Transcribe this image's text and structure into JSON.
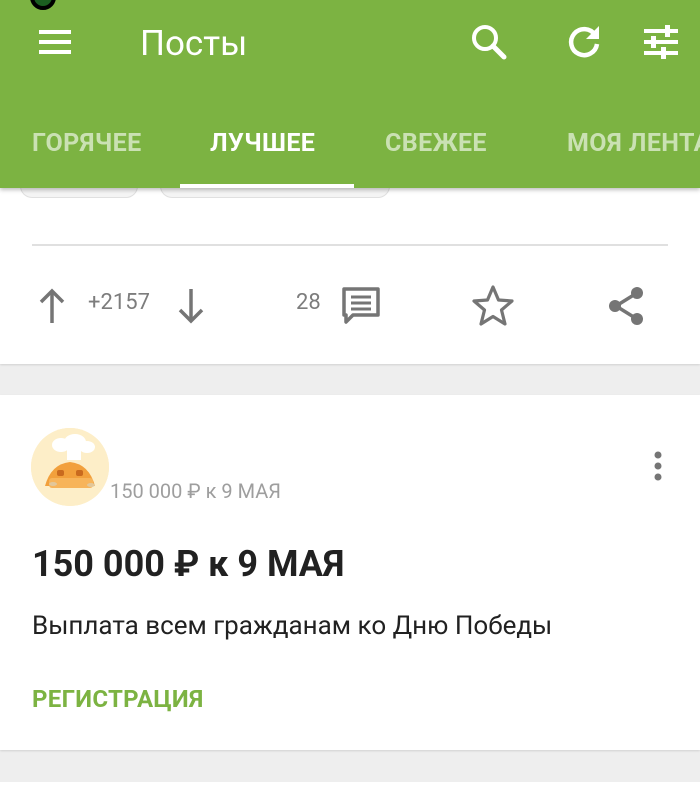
{
  "app_bar": {
    "title": "Посты",
    "menu_icon": "hamburger-menu-icon",
    "search_icon": "search-icon",
    "refresh_icon": "refresh-icon",
    "filter_icon": "filter-settings-icon",
    "color": "#7cb342"
  },
  "tabs": [
    {
      "label": "ГОРЯЧЕЕ",
      "active": false
    },
    {
      "label": "ЛУЧШЕЕ",
      "active": true
    },
    {
      "label": "СВЕЖЕЕ",
      "active": false
    },
    {
      "label": "МОЯ ЛЕНТА",
      "active": false
    }
  ],
  "post": {
    "rating": "+2157",
    "comments": "28",
    "upvote_icon": "arrow-up-icon",
    "downvote_icon": "arrow-down-icon",
    "comment_icon": "comment-icon",
    "save_icon": "star-icon",
    "share_icon": "share-icon"
  },
  "ad": {
    "author": "150 000 ₽ к 9 МАЯ",
    "title": "150 000 ₽ к 9 МАЯ",
    "description": "Выплата всем гражданам ко Дню Победы",
    "cta": "РЕГИСТРАЦИЯ",
    "more_icon": "more-vertical-icon",
    "accent": "#7cb342"
  }
}
